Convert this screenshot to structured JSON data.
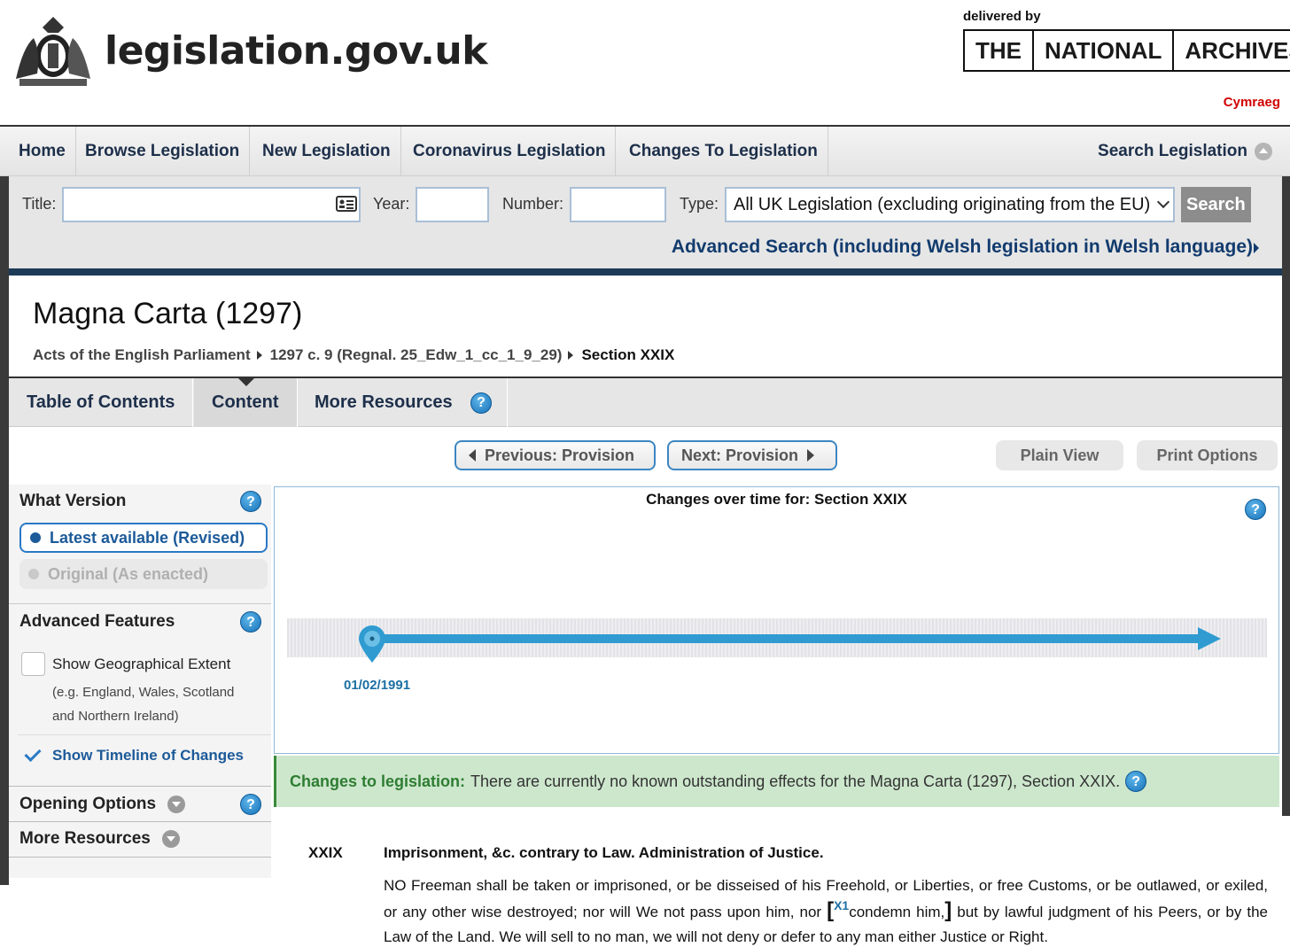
{
  "header": {
    "site_name": "legislation.gov.uk",
    "delivered_by": "delivered by",
    "tna_words": [
      "THE",
      "NATIONAL",
      "ARCHIVES"
    ],
    "language_link": "Cymraeg"
  },
  "nav": {
    "items": [
      "Home",
      "Browse Legislation",
      "New Legislation",
      "Coronavirus Legislation",
      "Changes To Legislation"
    ],
    "search_toggle": "Search Legislation"
  },
  "search": {
    "title_label": "Title:",
    "title_value": "",
    "year_label": "Year:",
    "year_value": "",
    "number_label": "Number:",
    "number_value": "",
    "type_label": "Type:",
    "type_value": "All UK Legislation (excluding originating from the EU)",
    "search_button": "Search",
    "advanced_link": "Advanced Search (including Welsh legislation in Welsh language)"
  },
  "page": {
    "title": "Magna Carta (1297)",
    "breadcrumb": [
      "Acts of the English Parliament",
      "1297 c. 9 (Regnal. 25_Edw_1_cc_1_9_29)",
      "Section XXIX"
    ]
  },
  "tabs": [
    "Table of Contents",
    "Content",
    "More Resources"
  ],
  "provision_nav": {
    "previous": "Previous: Provision",
    "next": "Next: Provision",
    "plain_view": "Plain View",
    "print_options": "Print Options"
  },
  "sidebar": {
    "what_version": "What Version",
    "latest": "Latest available (Revised)",
    "original": "Original (As enacted)",
    "advanced_features": "Advanced Features",
    "geo_extent": "Show Geographical Extent",
    "geo_sub_1": "(e.g. England, Wales, Scotland",
    "geo_sub_2": "and Northern Ireland)",
    "geo_checked": false,
    "timeline_option": "Show Timeline of Changes",
    "timeline_checked": true,
    "opening_options": "Opening Options",
    "more_resources": "More Resources"
  },
  "timeline": {
    "title": "Changes over time for: Section XXIX",
    "date": "01/02/1991"
  },
  "changes": {
    "label": "Changes to legislation:",
    "text": "There are currently no known outstanding effects for the Magna Carta (1297), Section XXIX."
  },
  "provision": {
    "number": "XXIX",
    "heading": "Imprisonment, &c. contrary to Law. Administration of Justice.",
    "text_before": "NO Freeman shall be taken or imprisoned, or be disseised of his Freehold, or Liberties, or free Customs, or be outlawed, or exiled, or any other wise destroyed; nor will We not pass upon him, nor ",
    "open_bracket": "[",
    "annotation_ref": "X1",
    "amended_text": "condemn him,",
    "close_bracket": "]",
    "text_after": " but by lawful judgment of his Peers, or by the Law of the Land. We will sell to no man, we will not deny or defer to any man either Justice or Right."
  },
  "help_icon": "?",
  "colors": {
    "brand_navy": "#1d3a57",
    "link_blue": "#1c5a99",
    "timeline_blue": "#2f9bd1",
    "changes_green": "#cde7cd",
    "cymraeg_red": "#d10000"
  }
}
